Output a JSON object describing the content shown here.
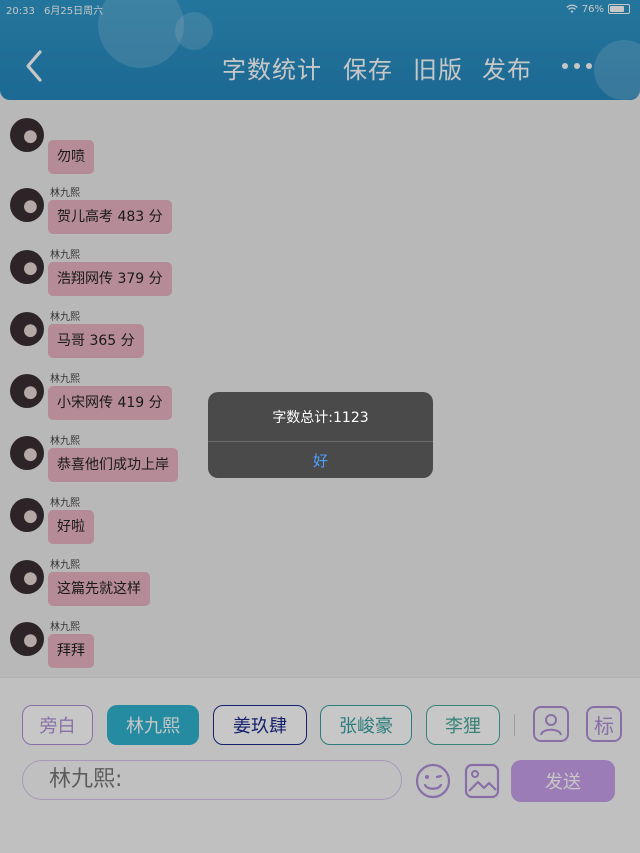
{
  "status_bar": {
    "time": "20:33",
    "date": "6月25日周六",
    "battery": "76%"
  },
  "header": {
    "word_count_label": "字数统计",
    "save_label": "保存",
    "old_version_label": "旧版",
    "publish_label": "发布"
  },
  "messages": [
    {
      "name": "",
      "text": "勿喷"
    },
    {
      "name": "林九熙",
      "text": "贺儿高考 483 分"
    },
    {
      "name": "林九熙",
      "text": "浩翔网传 379 分"
    },
    {
      "name": "林九熙",
      "text": "马哥 365 分"
    },
    {
      "name": "林九熙",
      "text": "小宋网传 419 分"
    },
    {
      "name": "林九熙",
      "text": "恭喜他们成功上岸"
    },
    {
      "name": "林九熙",
      "text": "好啦"
    },
    {
      "name": "林九熙",
      "text": "这篇先就这样"
    },
    {
      "name": "林九熙",
      "text": "拜拜"
    }
  ],
  "characters": [
    {
      "label": "旁白",
      "color": "#b08fd8"
    },
    {
      "label": "林九熙",
      "color": "#2fb2cf"
    },
    {
      "label": "姜玖肆",
      "color": "#1c2b8c"
    },
    {
      "label": "张峻豪",
      "color": "#38a0a0"
    },
    {
      "label": "李狸",
      "color": "#4aa89a"
    }
  ],
  "input": {
    "value": "林九熙:"
  },
  "send_label": "发送",
  "tag_label": "标",
  "alert": {
    "message": "字数总计:1123",
    "button": "好"
  }
}
